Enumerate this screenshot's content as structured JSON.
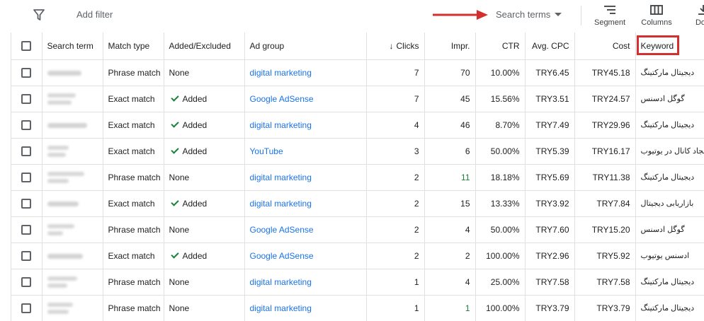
{
  "toolbar": {
    "add_filter": "Add filter",
    "search_terms": "Search terms",
    "segment": "Segment",
    "columns": "Columns",
    "download": "Dow"
  },
  "annotation_color": "#d32f2f",
  "columns": {
    "search_term": "Search term",
    "match_type": "Match type",
    "added_excluded": "Added/Excluded",
    "ad_group": "Ad group",
    "clicks": "Clicks",
    "impr": "Impr.",
    "ctr": "CTR",
    "avg_cpc": "Avg. CPC",
    "cost": "Cost",
    "keyword": "Keyword"
  },
  "rows": [
    {
      "match_type": "Phrase match",
      "status": "None",
      "ad_group": "digital marketing",
      "clicks": "7",
      "impr": "70",
      "ctr": "10.00%",
      "avg_cpc": "TRY6.45",
      "cost": "TRY45.18",
      "keyword": "دیجیتال مارکتینگ"
    },
    {
      "match_type": "Exact match",
      "status": "Added",
      "ad_group": "Google AdSense",
      "clicks": "7",
      "impr": "45",
      "ctr": "15.56%",
      "avg_cpc": "TRY3.51",
      "cost": "TRY24.57",
      "keyword": "گوگل ادسنس"
    },
    {
      "match_type": "Exact match",
      "status": "Added",
      "ad_group": "digital marketing",
      "clicks": "4",
      "impr": "46",
      "ctr": "8.70%",
      "avg_cpc": "TRY7.49",
      "cost": "TRY29.96",
      "keyword": "دیجیتال مارکتینگ"
    },
    {
      "match_type": "Exact match",
      "status": "Added",
      "ad_group": "YouTube",
      "clicks": "3",
      "impr": "6",
      "ctr": "50.00%",
      "avg_cpc": "TRY5.39",
      "cost": "TRY16.17",
      "keyword": "ایجاد کانال در یوتیوب"
    },
    {
      "match_type": "Phrase match",
      "status": "None",
      "ad_group": "digital marketing",
      "clicks": "2",
      "impr": "11",
      "ctr": "18.18%",
      "avg_cpc": "TRY5.69",
      "cost": "TRY11.38",
      "keyword": "دیجیتال مارکتینگ"
    },
    {
      "match_type": "Exact match",
      "status": "Added",
      "ad_group": "digital marketing",
      "clicks": "2",
      "impr": "15",
      "ctr": "13.33%",
      "avg_cpc": "TRY3.92",
      "cost": "TRY7.84",
      "keyword": "بازاریابی دیجیتال"
    },
    {
      "match_type": "Phrase match",
      "status": "None",
      "ad_group": "Google AdSense",
      "clicks": "2",
      "impr": "4",
      "ctr": "50.00%",
      "avg_cpc": "TRY7.60",
      "cost": "TRY15.20",
      "keyword": "گوگل ادسنس"
    },
    {
      "match_type": "Exact match",
      "status": "Added",
      "ad_group": "Google AdSense",
      "clicks": "2",
      "impr": "2",
      "ctr": "100.00%",
      "avg_cpc": "TRY2.96",
      "cost": "TRY5.92",
      "keyword": "ادسنس یوتیوب"
    },
    {
      "match_type": "Phrase match",
      "status": "None",
      "ad_group": "digital marketing",
      "clicks": "1",
      "impr": "4",
      "ctr": "25.00%",
      "avg_cpc": "TRY7.58",
      "cost": "TRY7.58",
      "keyword": "دیجیتال مارکتینگ"
    },
    {
      "match_type": "Phrase match",
      "status": "None",
      "ad_group": "digital marketing",
      "clicks": "1",
      "impr": "1",
      "ctr": "100.00%",
      "avg_cpc": "TRY3.79",
      "cost": "TRY3.79",
      "keyword": "دیجیتال مارکتینگ"
    }
  ]
}
